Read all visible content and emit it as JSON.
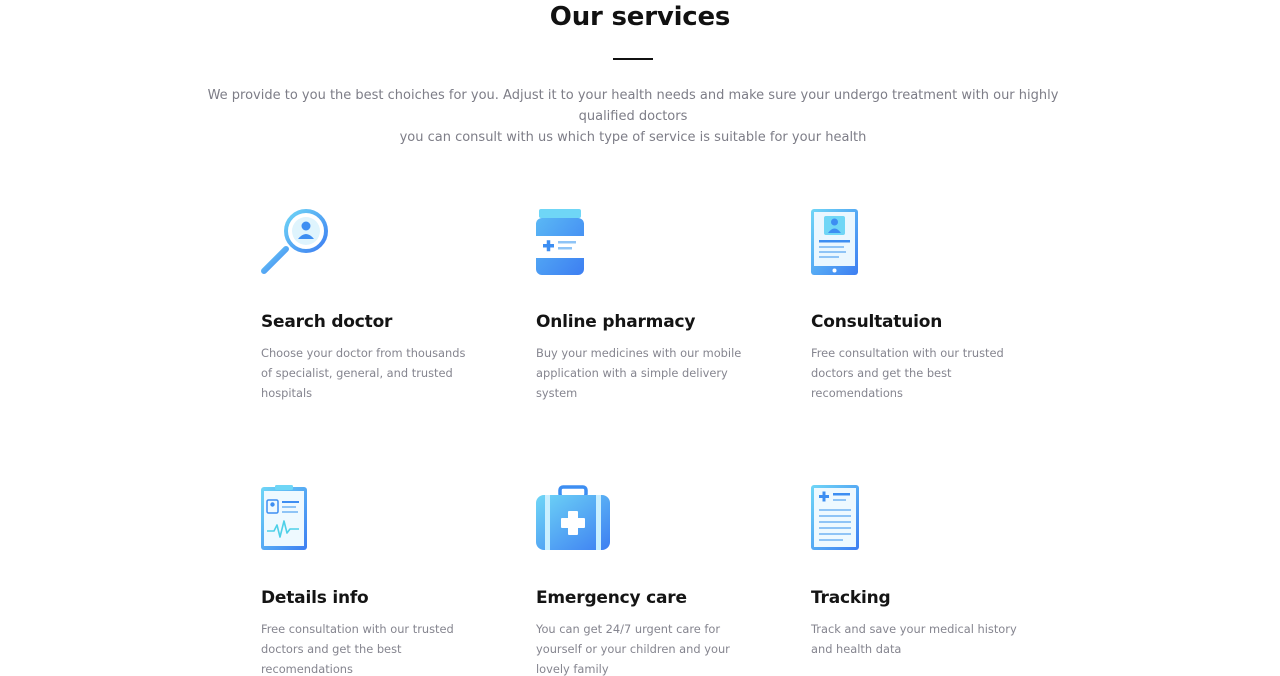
{
  "section": {
    "title": "Our services",
    "intro_lines": [
      "We provide to you the best choiches for you. Adjust it to your health needs and make sure your undergo treatment with our highly qualified doctors",
      "you can consult with us which type of service is suitable for your health"
    ]
  },
  "colors": {
    "icon_light": "#6fd6f6",
    "icon_dark": "#3d7ef2",
    "heading": "#141414",
    "body_text": "#85858f"
  },
  "services": [
    {
      "icon": "search-doctor-icon",
      "title": "Search doctor",
      "desc": [
        "Choose your doctor from thousands",
        "of specialist, general, and trusted",
        "hospitals"
      ]
    },
    {
      "icon": "medicine-bottle-icon",
      "title": "Online pharmacy",
      "desc": [
        "Buy your medicines with our mobile",
        "application with a simple delivery",
        "system"
      ]
    },
    {
      "icon": "tablet-profile-icon",
      "title": "Consultatuion",
      "desc": [
        "Free consultation with our trusted",
        "doctors and get the best",
        "recomendations"
      ]
    },
    {
      "icon": "clipboard-heartbeat-icon",
      "title": "Details info",
      "desc": [
        "Free consultation with our trusted",
        "doctors and get the best",
        "recomendations"
      ]
    },
    {
      "icon": "first-aid-kit-icon",
      "title": "Emergency care",
      "desc": [
        "You can get 24/7 urgent care for",
        "yourself or your children and your",
        "lovely family"
      ]
    },
    {
      "icon": "medical-record-icon",
      "title": "Tracking",
      "desc": [
        "Track and save your medical history",
        "and health data"
      ]
    }
  ]
}
